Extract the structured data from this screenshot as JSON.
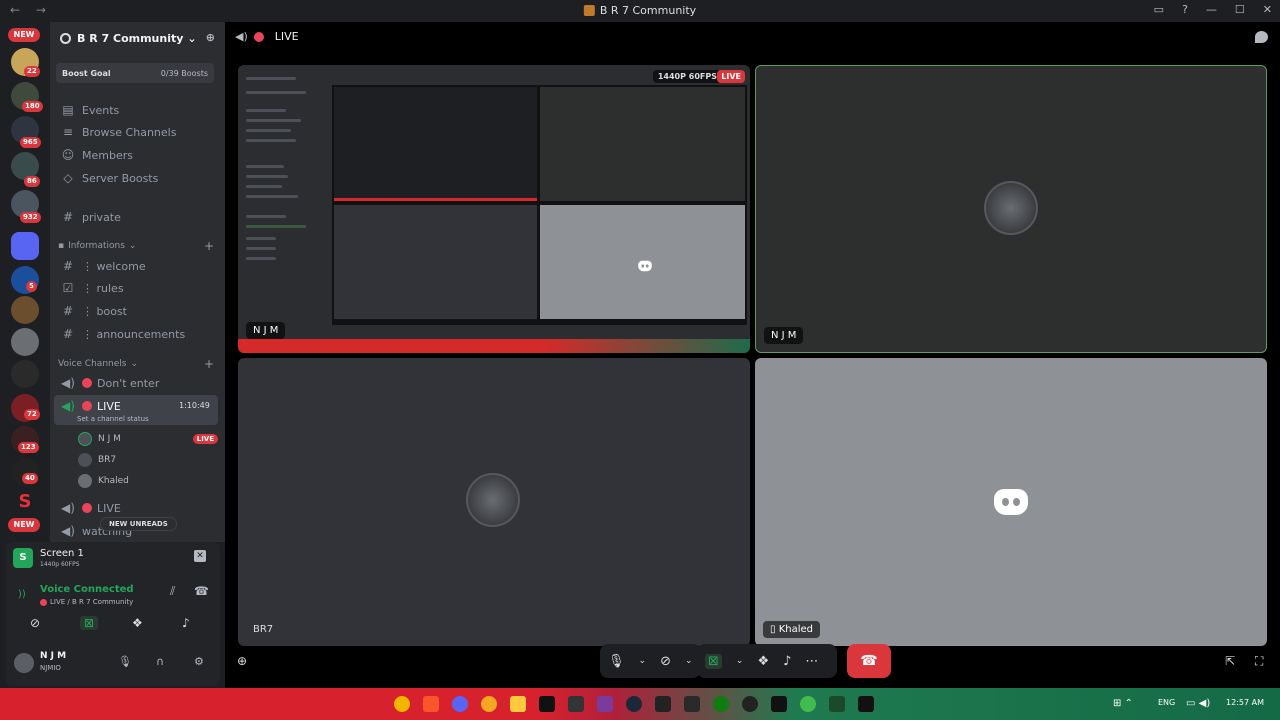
{
  "window": {
    "title": "B R 7 Community",
    "nav": "← →"
  },
  "servers": {
    "new_top": "NEW",
    "new_bottom": "NEW",
    "counts": [
      "22",
      "180",
      "965",
      "86",
      "932",
      "5",
      "72",
      "123",
      "40"
    ]
  },
  "guild": {
    "name": "B R 7 Community",
    "boost_goal_label": "Boost Goal",
    "boost_goal_value": "0/39 Boosts",
    "menu": [
      "Events",
      "Browse Channels",
      "Members",
      "Server Boosts"
    ],
    "private_channel": "private",
    "cat_info": "Informations",
    "text_channels": [
      "welcome",
      "rules",
      "boost",
      "announcements"
    ],
    "cat_voice": "Voice Channels",
    "voice_channels": {
      "dont_enter": "Don't enter",
      "live": "LIVE",
      "live_time": "1:10:49",
      "status_hint": "Set a channel status",
      "live2": "LIVE",
      "watching": "watching"
    },
    "members": [
      {
        "name": "N J M",
        "badge": "LIVE"
      },
      {
        "name": "BR7"
      },
      {
        "name": "Khaled"
      }
    ],
    "new_unreads": "NEW UNREADS"
  },
  "panel": {
    "screen_title": "Screen 1",
    "screen_quality": "1440p 60FPS",
    "voice_status": "Voice Connected",
    "voice_channel": "LIVE / B R 7 Community",
    "user_name": "N J M",
    "user_tag": "NJMIO"
  },
  "main": {
    "channel": "LIVE",
    "tiles": {
      "share_quality": "1440P 60FPS",
      "share_live": "LIVE",
      "share_name": "N J M",
      "njm_name": "N J M",
      "br7_name": "BR7",
      "khaled_name": "Khaled"
    }
  },
  "taskbar": {
    "lang": "ENG",
    "time": "12:57 AM"
  },
  "colors": {
    "live_red": "#da373c",
    "connected_green": "#23a55a",
    "sidebar": "#2b2d31"
  }
}
